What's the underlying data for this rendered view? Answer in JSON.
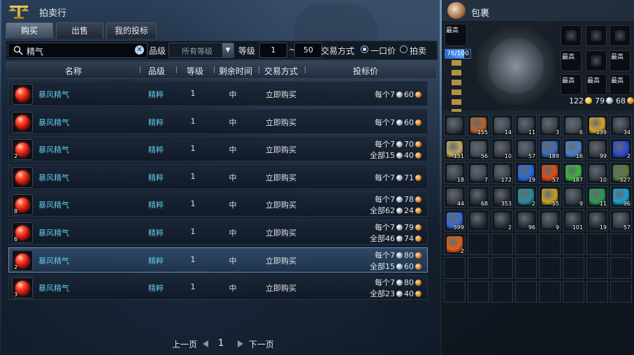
{
  "auction": {
    "title": "拍卖行",
    "tabs": [
      "购买",
      "出售",
      "我的投标"
    ],
    "search": {
      "value": "精气"
    },
    "grade_label": "品级",
    "grade_value": "所有等级",
    "level_label": "等级",
    "level_min": "1",
    "level_sep": "~",
    "level_max": "50",
    "trade_label": "交易方式",
    "trade_options": [
      "一口价",
      "拍卖"
    ],
    "headers": {
      "name": "名称",
      "grade": "品级",
      "level": "等级",
      "time": "剩余时间",
      "trade": "交易方式",
      "price": "投标价"
    },
    "rows": [
      {
        "qty": "",
        "name": "暴风精气",
        "grade": "精粹",
        "level": "1",
        "time": "中",
        "trade": "立即购买",
        "each_label": "每个7",
        "each_cu": "60",
        "all_label": "",
        "all_cu": ""
      },
      {
        "qty": "",
        "name": "暴风精气",
        "grade": "精粹",
        "level": "1",
        "time": "中",
        "trade": "立即购买",
        "each_label": "每个7",
        "each_cu": "60",
        "all_label": "",
        "all_cu": ""
      },
      {
        "qty": "2",
        "name": "暴风精气",
        "grade": "精粹",
        "level": "1",
        "time": "中",
        "trade": "立即购买",
        "each_label": "每个7",
        "each_cu": "70",
        "all_label": "全部15",
        "all_cu": "40"
      },
      {
        "qty": "",
        "name": "暴风精气",
        "grade": "精粹",
        "level": "1",
        "time": "中",
        "trade": "立即购买",
        "each_label": "每个7",
        "each_cu": "71",
        "all_label": "",
        "all_cu": ""
      },
      {
        "qty": "8",
        "name": "暴风精气",
        "grade": "精粹",
        "level": "1",
        "time": "中",
        "trade": "立即购买",
        "each_label": "每个7",
        "each_cu": "78",
        "all_label": "全部62",
        "all_cu": "24"
      },
      {
        "qty": "6",
        "name": "暴风精气",
        "grade": "精粹",
        "level": "1",
        "time": "中",
        "trade": "立即购买",
        "each_label": "每个7",
        "each_cu": "79",
        "all_label": "全部46",
        "all_cu": "74"
      },
      {
        "qty": "2",
        "name": "暴风精气",
        "grade": "精粹",
        "level": "1",
        "time": "中",
        "trade": "立即购买",
        "each_label": "每个7",
        "each_cu": "80",
        "all_label": "全部15",
        "all_cu": "60"
      },
      {
        "qty": "3",
        "name": "暴风精气",
        "grade": "精粹",
        "level": "1",
        "time": "中",
        "trade": "立即购买",
        "each_label": "每个7",
        "each_cu": "80",
        "all_label": "全部23",
        "all_cu": "40"
      }
    ],
    "selected_row": 6,
    "pager": {
      "prev": "上一页",
      "page": "1",
      "next": "下一页"
    }
  },
  "bag": {
    "title": "包裹",
    "hp_text": "76/100",
    "hp_fraction": 0.76,
    "slot_tag": "最高",
    "money": {
      "gold": "122",
      "silver": "79",
      "copper": "68"
    },
    "items": [
      {
        "n": "",
        "color": "#3a3f48"
      },
      {
        "n": "155",
        "color": "#b8642a"
      },
      {
        "n": "14",
        "color": "#444a54"
      },
      {
        "n": "11",
        "color": "#3c424c"
      },
      {
        "n": "3",
        "color": "#40454e"
      },
      {
        "n": "6",
        "color": "#4a4f58"
      },
      {
        "n": "139",
        "color": "#d8a52a"
      },
      {
        "n": "34",
        "color": "#3a4048"
      },
      {
        "n": "151",
        "color": "#c8a860"
      },
      {
        "n": "56",
        "color": "#4a4f58"
      },
      {
        "n": "10",
        "color": "#3c424c"
      },
      {
        "n": "57",
        "color": "#444a54"
      },
      {
        "n": "189",
        "color": "#3a6ab8"
      },
      {
        "n": "16",
        "color": "#4a82c8"
      },
      {
        "n": "99",
        "color": "#3c424c"
      },
      {
        "n": "2",
        "color": "#2a4ad0"
      },
      {
        "n": "18",
        "color": "#3c424c"
      },
      {
        "n": "7",
        "color": "#444a54"
      },
      {
        "n": "172",
        "color": "#40454e"
      },
      {
        "n": "19",
        "color": "#2a6ad8"
      },
      {
        "n": "57",
        "color": "#e04a10"
      },
      {
        "n": "187",
        "color": "#38b83a"
      },
      {
        "n": "10",
        "color": "#3c424c"
      },
      {
        "n": "527",
        "color": "#5a7a3a"
      },
      {
        "n": "44",
        "color": "#3a4048"
      },
      {
        "n": "68",
        "color": "#2e333a"
      },
      {
        "n": "353",
        "color": "#2e333a"
      },
      {
        "n": "2",
        "color": "#2a8a9a"
      },
      {
        "n": "55",
        "color": "#c8a020"
      },
      {
        "n": "9",
        "color": "#3c424c"
      },
      {
        "n": "11",
        "color": "#2a9a4a"
      },
      {
        "n": "96",
        "color": "#1aa0d0"
      },
      {
        "n": "599",
        "color": "#3a6ad0"
      },
      {
        "n": "",
        "color": "#2e333a"
      },
      {
        "n": "2",
        "color": "#2e333a"
      },
      {
        "n": "96",
        "color": "#2e333a"
      },
      {
        "n": "9",
        "color": "#3a3f48"
      },
      {
        "n": "101",
        "color": "#2e333a"
      },
      {
        "n": "19",
        "color": "#2e333a"
      },
      {
        "n": "57",
        "color": "#3a3f48"
      },
      {
        "n": "2",
        "color": "#e06010"
      }
    ],
    "empty_cells": 23
  }
}
